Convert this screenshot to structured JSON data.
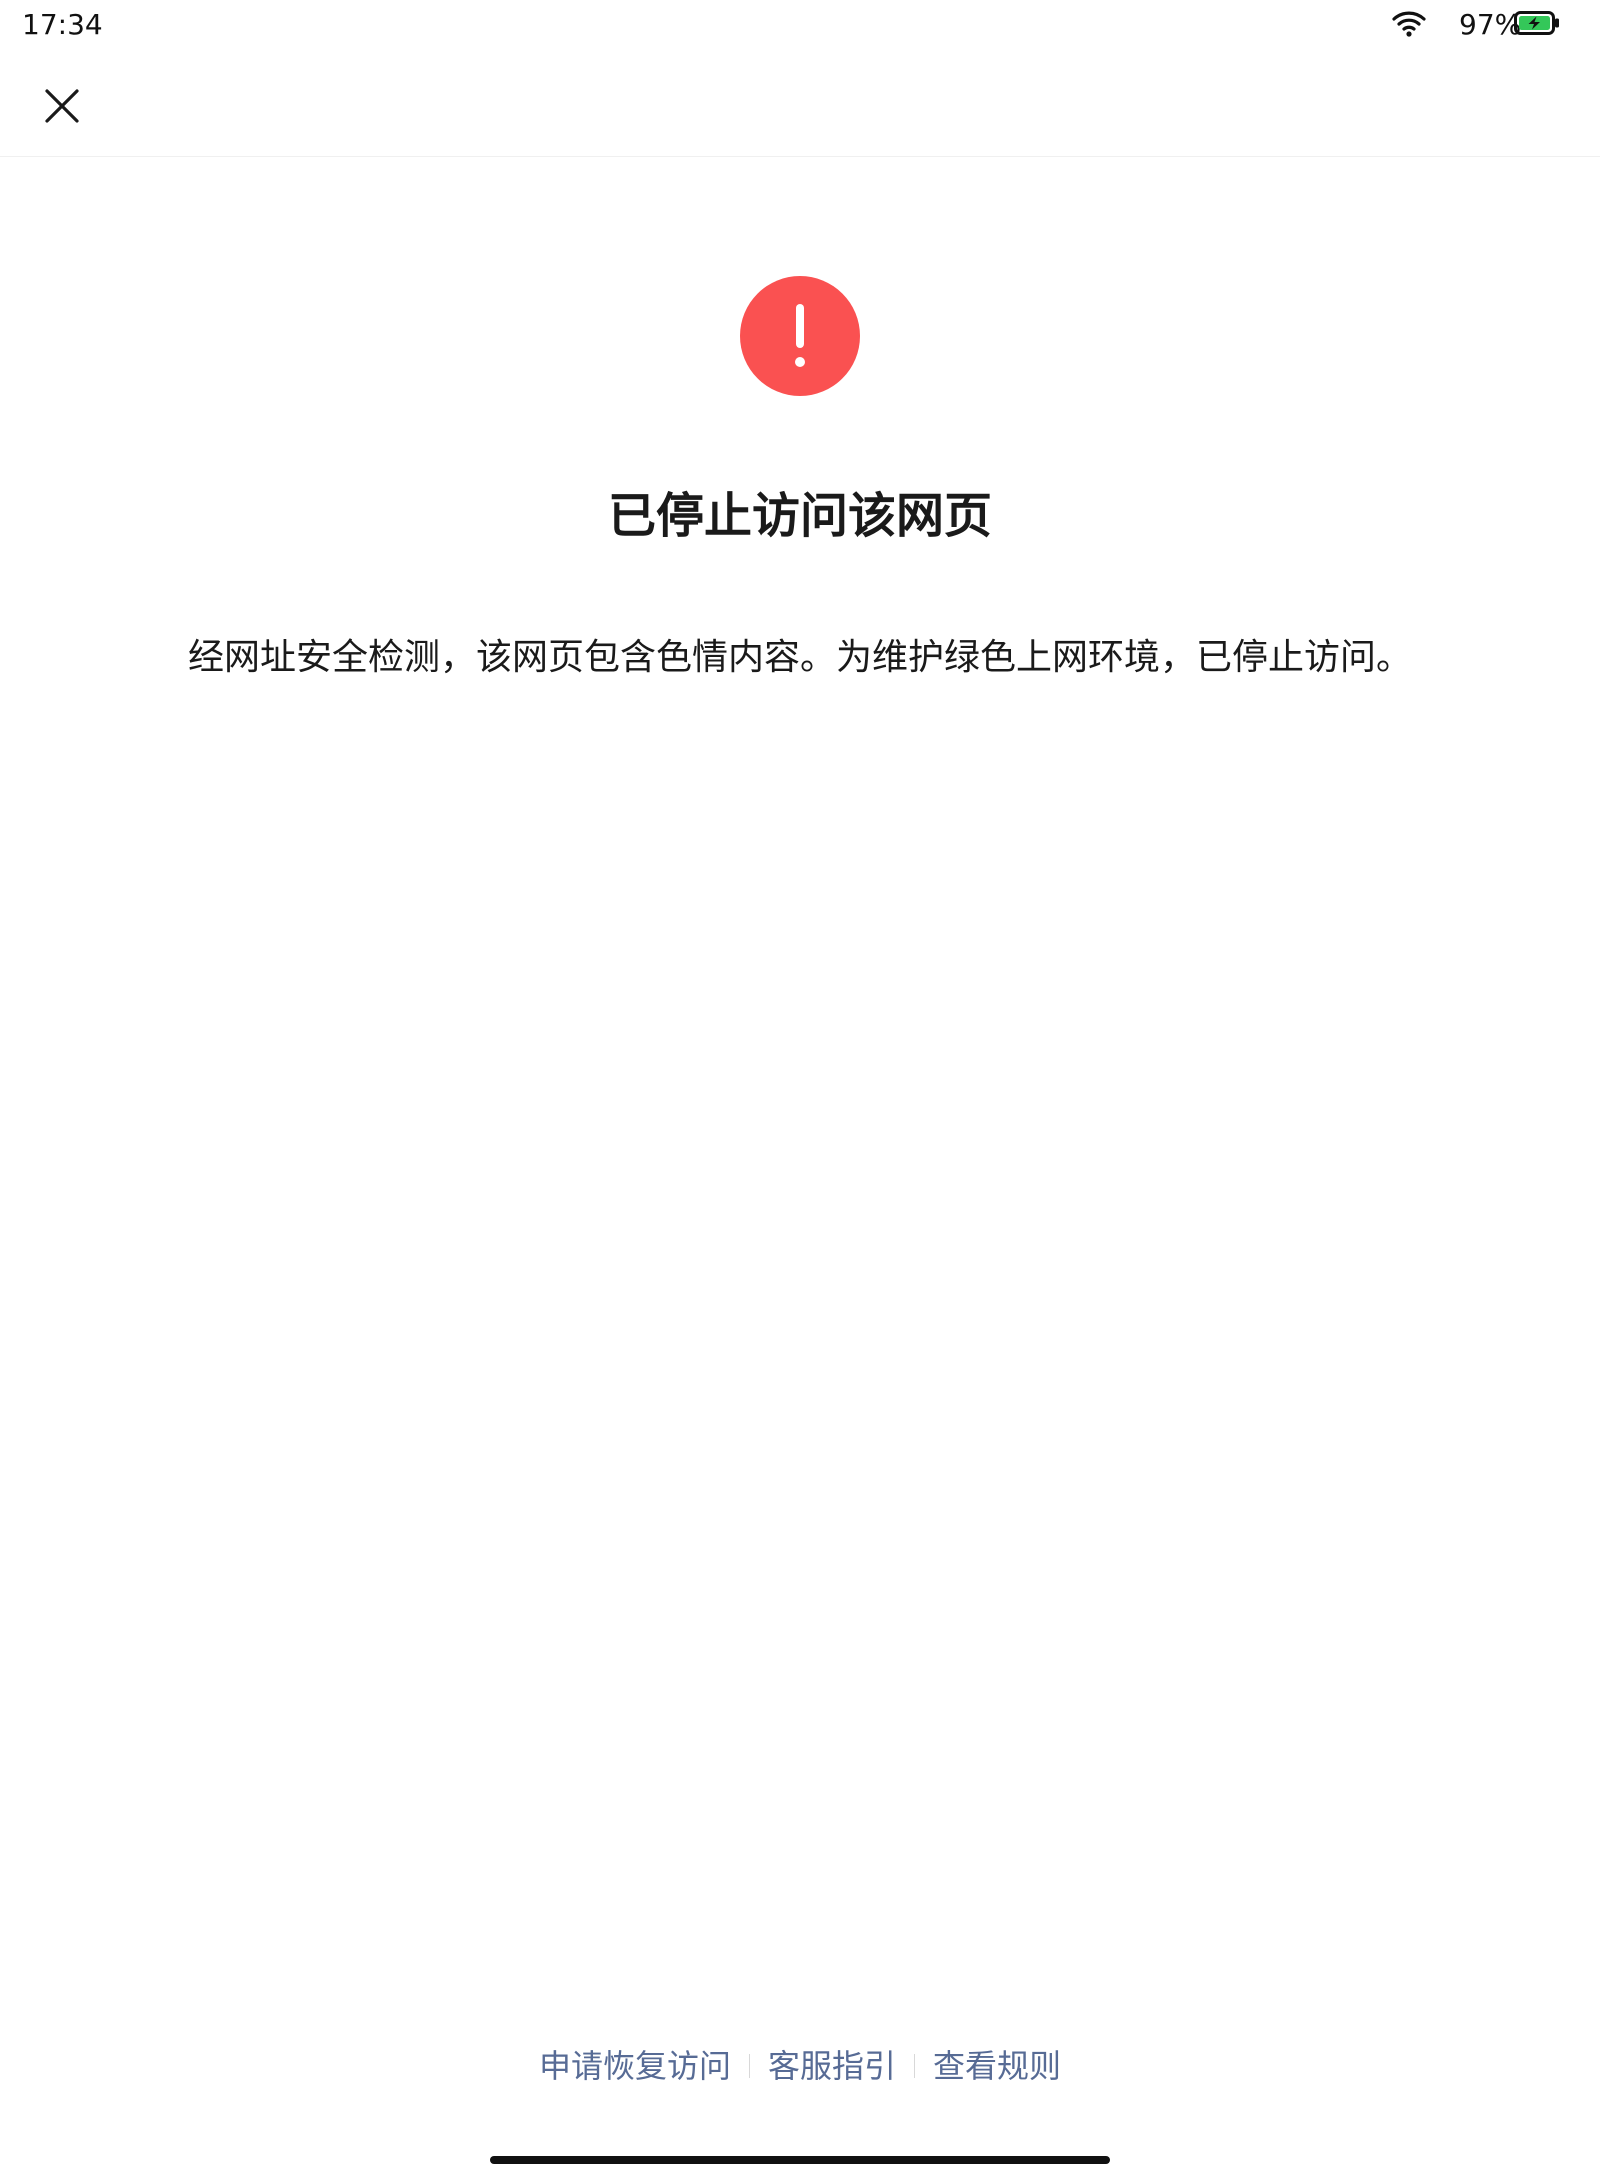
{
  "status_bar": {
    "time": "17:34",
    "battery_percent": "97%",
    "wifi_icon": "wifi-icon",
    "battery_icon": "battery-charging-icon",
    "battery_color": "#34c759"
  },
  "nav": {
    "close_icon": "close-icon"
  },
  "main": {
    "alert_icon": "exclamation-circle-icon",
    "alert_color": "#fa5151",
    "title": "已停止访问该网页",
    "message": "经网址安全检测，该网页包含色情内容。为维护绿色上网环境，已停止访问。"
  },
  "footer": {
    "link_color": "#576b95",
    "links": [
      {
        "label": "申请恢复访问"
      },
      {
        "label": "客服指引"
      },
      {
        "label": "查看规则"
      }
    ]
  }
}
